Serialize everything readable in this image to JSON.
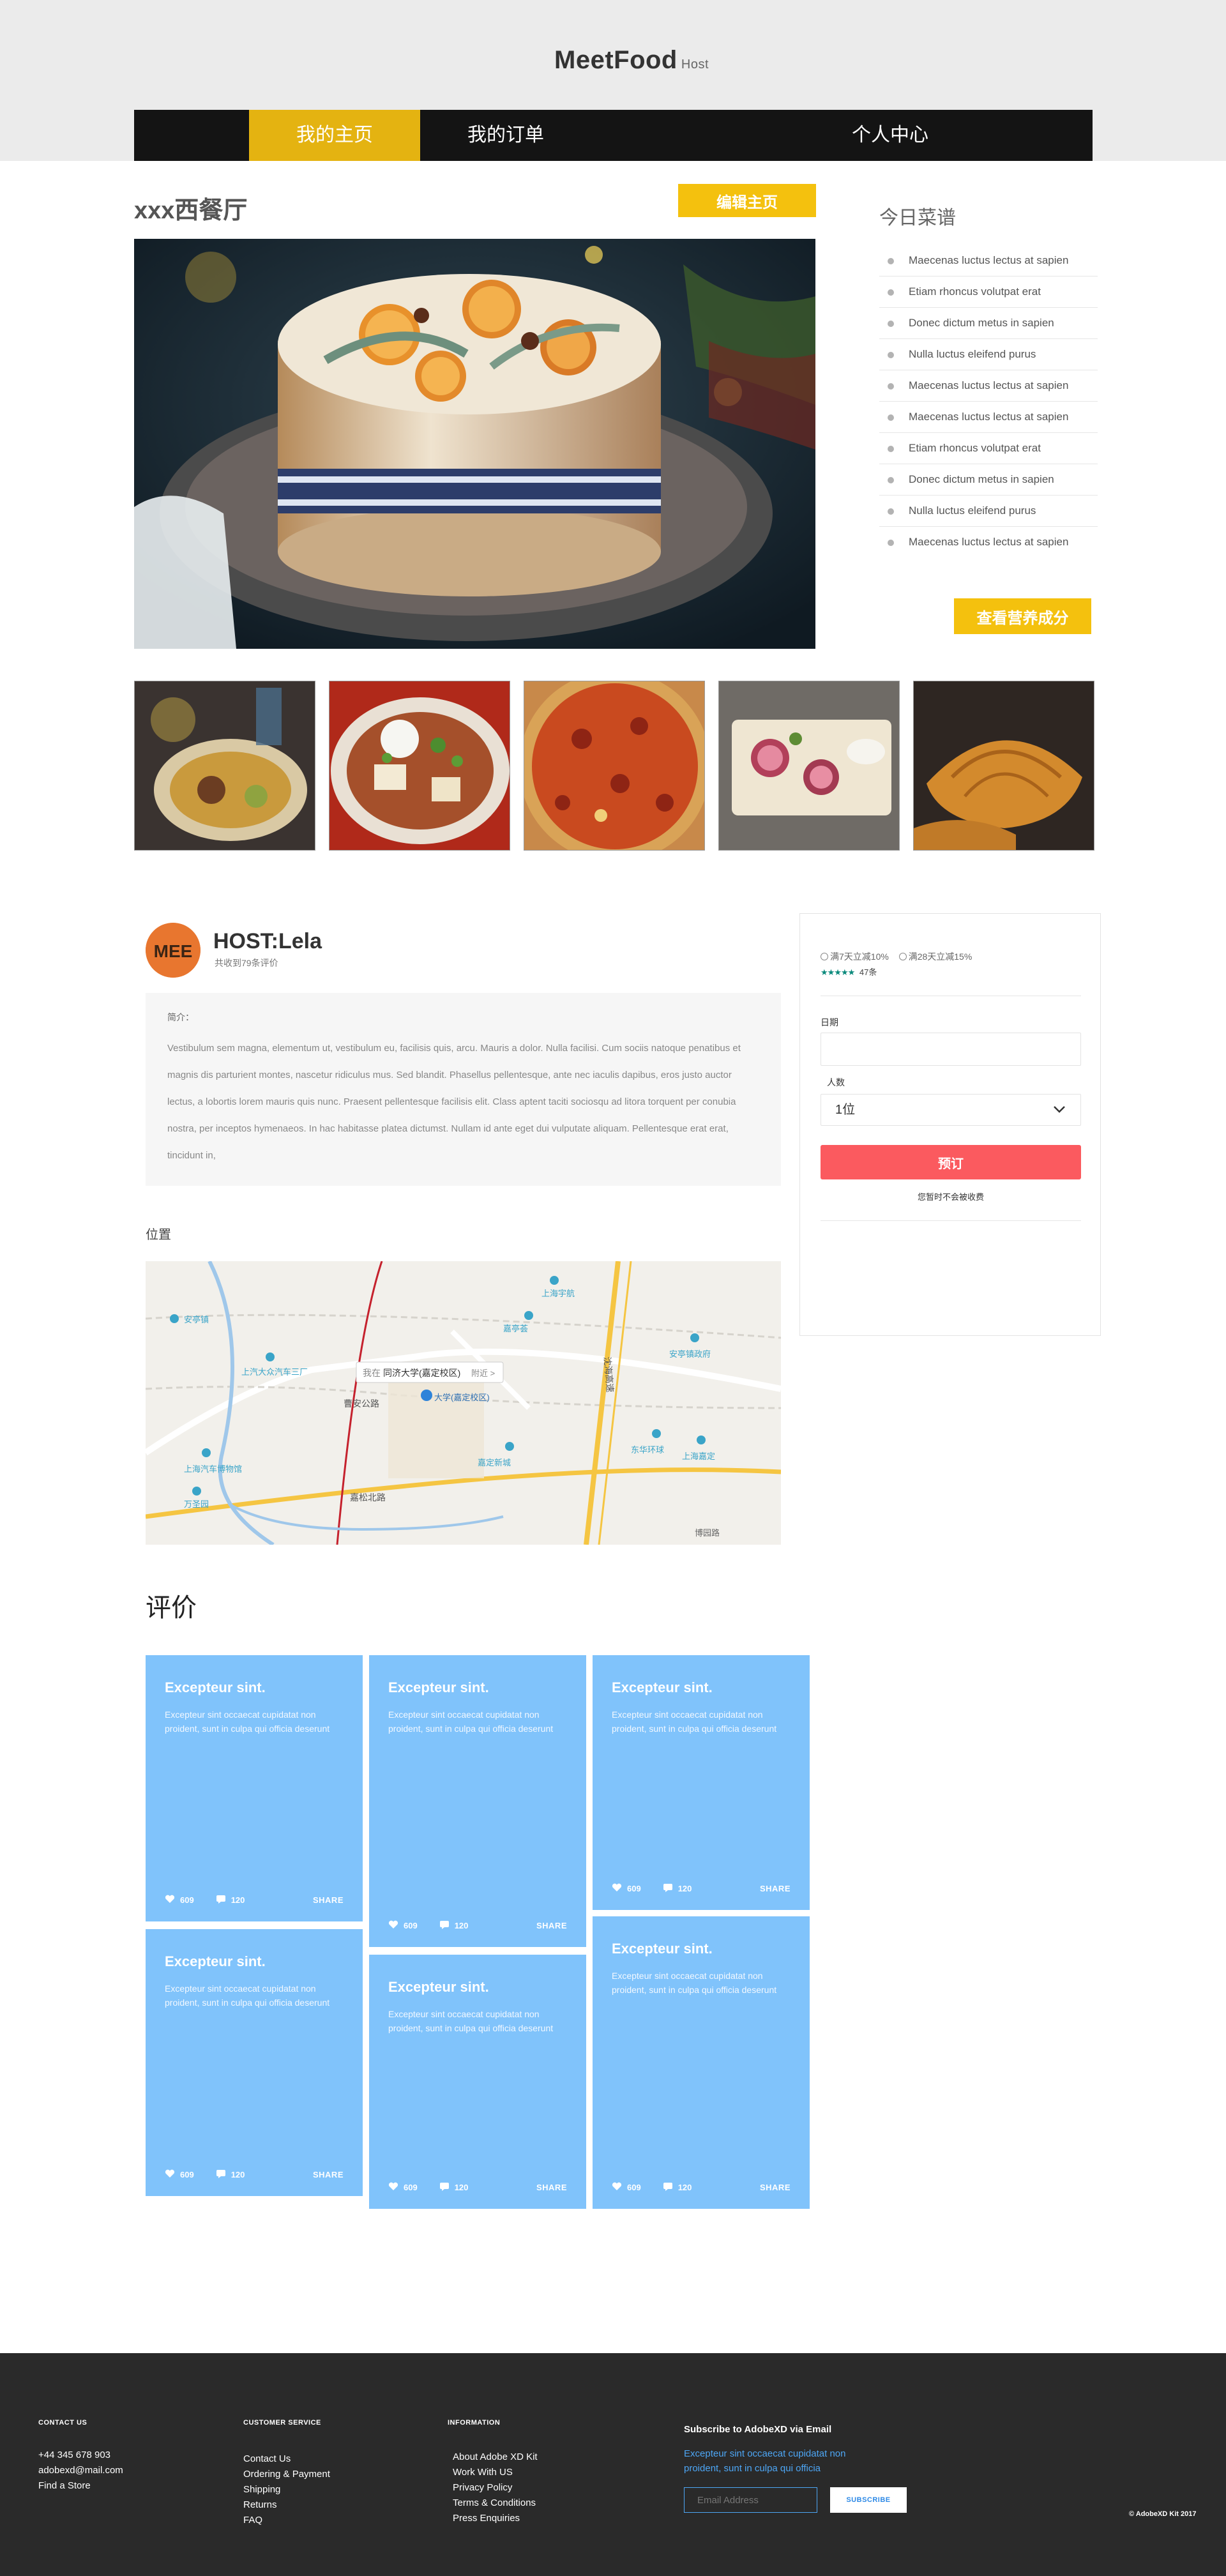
{
  "header": {
    "brand": "MeetFood",
    "brand_suffix": "Host"
  },
  "nav": {
    "items": [
      {
        "label": "我的主页"
      },
      {
        "label": "我的订单"
      },
      {
        "label": "个人中心"
      }
    ]
  },
  "restaurant": {
    "name": "xxx西餐厅",
    "edit_button": "编辑主页"
  },
  "today_menu": {
    "title": "今日菜谱",
    "items": [
      "Maecenas luctus lectus at sapien",
      "Etiam rhoncus volutpat erat",
      "Donec dictum metus in sapien",
      "Nulla luctus eleifend purus",
      "Maecenas luctus lectus at sapien",
      "Maecenas luctus lectus at sapien",
      "Etiam rhoncus volutpat erat",
      "Donec dictum metus in sapien",
      "Nulla luctus eleifend purus",
      "Maecenas luctus lectus at sapien"
    ],
    "nutrition_button": "查看营养成分"
  },
  "host": {
    "avatar_text": "MEE",
    "name": "HOST:Lela",
    "reviews_count": "共收到79条评价",
    "intro_label": "简介：",
    "intro_text": "Vestibulum sem magna, elementum ut, vestibulum eu, facilisis quis, arcu. Mauris a dolor. Nulla facilisi. Cum sociis natoque penatibus et magnis dis parturient montes, nascetur ridiculus mus. Sed blandit. Phasellus pellentesque, ante nec iaculis dapibus, eros justo auctor lectus, a lobortis lorem mauris quis nunc. Praesent pellentesque facilisis elit. Class aptent taciti sociosqu ad litora torquent per conubia nostra, per inceptos hymenaeos. In hac habitasse platea dictumst. Nullam id ante eget dui vulputate aliquam. Pellentesque erat erat, tincidunt in,"
  },
  "location": {
    "label": "位置",
    "map_labels": {
      "popup_prefix": "我在",
      "popup_place": "同济大学(嘉定校区)",
      "popup_suffix": "附近 >",
      "pin": "大学(嘉定校区)",
      "road1": "曹安公路",
      "road2": "嘉松北路",
      "road3": "沈海高速",
      "poi1": "上海宇航",
      "poi2": "上汽大众汽车三厂",
      "poi3": "安亭镇",
      "poi4": "上海汽车博物馆",
      "poi5": "万圣园",
      "poi6": "嘉定新城",
      "poi7": "东华环球",
      "poi8": "上海嘉定",
      "poi9": "嘉亭荟",
      "poi10": "安亭镇政府",
      "poi11": "博园路"
    }
  },
  "booking": {
    "promo1": "满7天立减10%",
    "promo2": "满28天立减15%",
    "rating_stars": "★★★★★",
    "rating_count": "47条",
    "date_label": "日期",
    "date_value": "",
    "people_label": "人数",
    "people_value": "1位",
    "book_button": "预订",
    "note": "您暂时不会被收费",
    "colors": {
      "book_button": "#fb5a5f",
      "stars": "#0b8a7c"
    }
  },
  "reviews": {
    "title": "评价",
    "cards": [
      {
        "title": "Excepteur sint.",
        "body": "Excepteur sint occaecat cupidatat non proident, sunt in culpa qui officia deserunt",
        "likes": "609",
        "comments": "120",
        "share": "SHARE"
      },
      {
        "title": "Excepteur sint.",
        "body": "Excepteur sint occaecat cupidatat non proident, sunt in culpa qui officia deserunt",
        "likes": "609",
        "comments": "120",
        "share": "SHARE"
      },
      {
        "title": "Excepteur sint.",
        "body": "Excepteur sint occaecat cupidatat non proident, sunt in culpa qui officia deserunt",
        "likes": "609",
        "comments": "120",
        "share": "SHARE"
      },
      {
        "title": "Excepteur sint.",
        "body": "Excepteur sint occaecat cupidatat non proident, sunt in culpa qui officia deserunt",
        "likes": "609",
        "comments": "120",
        "share": "SHARE"
      },
      {
        "title": "Excepteur sint.",
        "body": "Excepteur sint occaecat cupidatat non proident, sunt in culpa qui officia deserunt",
        "likes": "609",
        "comments": "120",
        "share": "SHARE"
      },
      {
        "title": "Excepteur sint.",
        "body": "Excepteur sint occaecat cupidatat non proident, sunt in culpa qui officia deserunt",
        "likes": "609",
        "comments": "120",
        "share": "SHARE"
      }
    ]
  },
  "footer": {
    "contact": {
      "title": "CONTACT US",
      "phone": "+44 345 678 903",
      "email": "adobexd@mail.com",
      "store": "Find a Store"
    },
    "service": {
      "title": "CUSTOMER SERVICE",
      "links": [
        "Contact Us",
        "Ordering & Payment",
        "Shipping",
        "Returns",
        "FAQ"
      ]
    },
    "info": {
      "title": "INFORMATION",
      "links": [
        "About Adobe XD Kit",
        "Work With US",
        "Privacy Policy",
        "Terms & Conditions",
        "Press Enquiries"
      ]
    },
    "subscribe": {
      "title": "Subscribe to AdobeXD via Email",
      "text": "Excepteur sint occaecat cupidatat non proident, sunt in culpa qui officia",
      "placeholder": "Email Address",
      "button": "SUBSCRIBE"
    },
    "copyright": "© AdobeXD Kit 2017"
  }
}
